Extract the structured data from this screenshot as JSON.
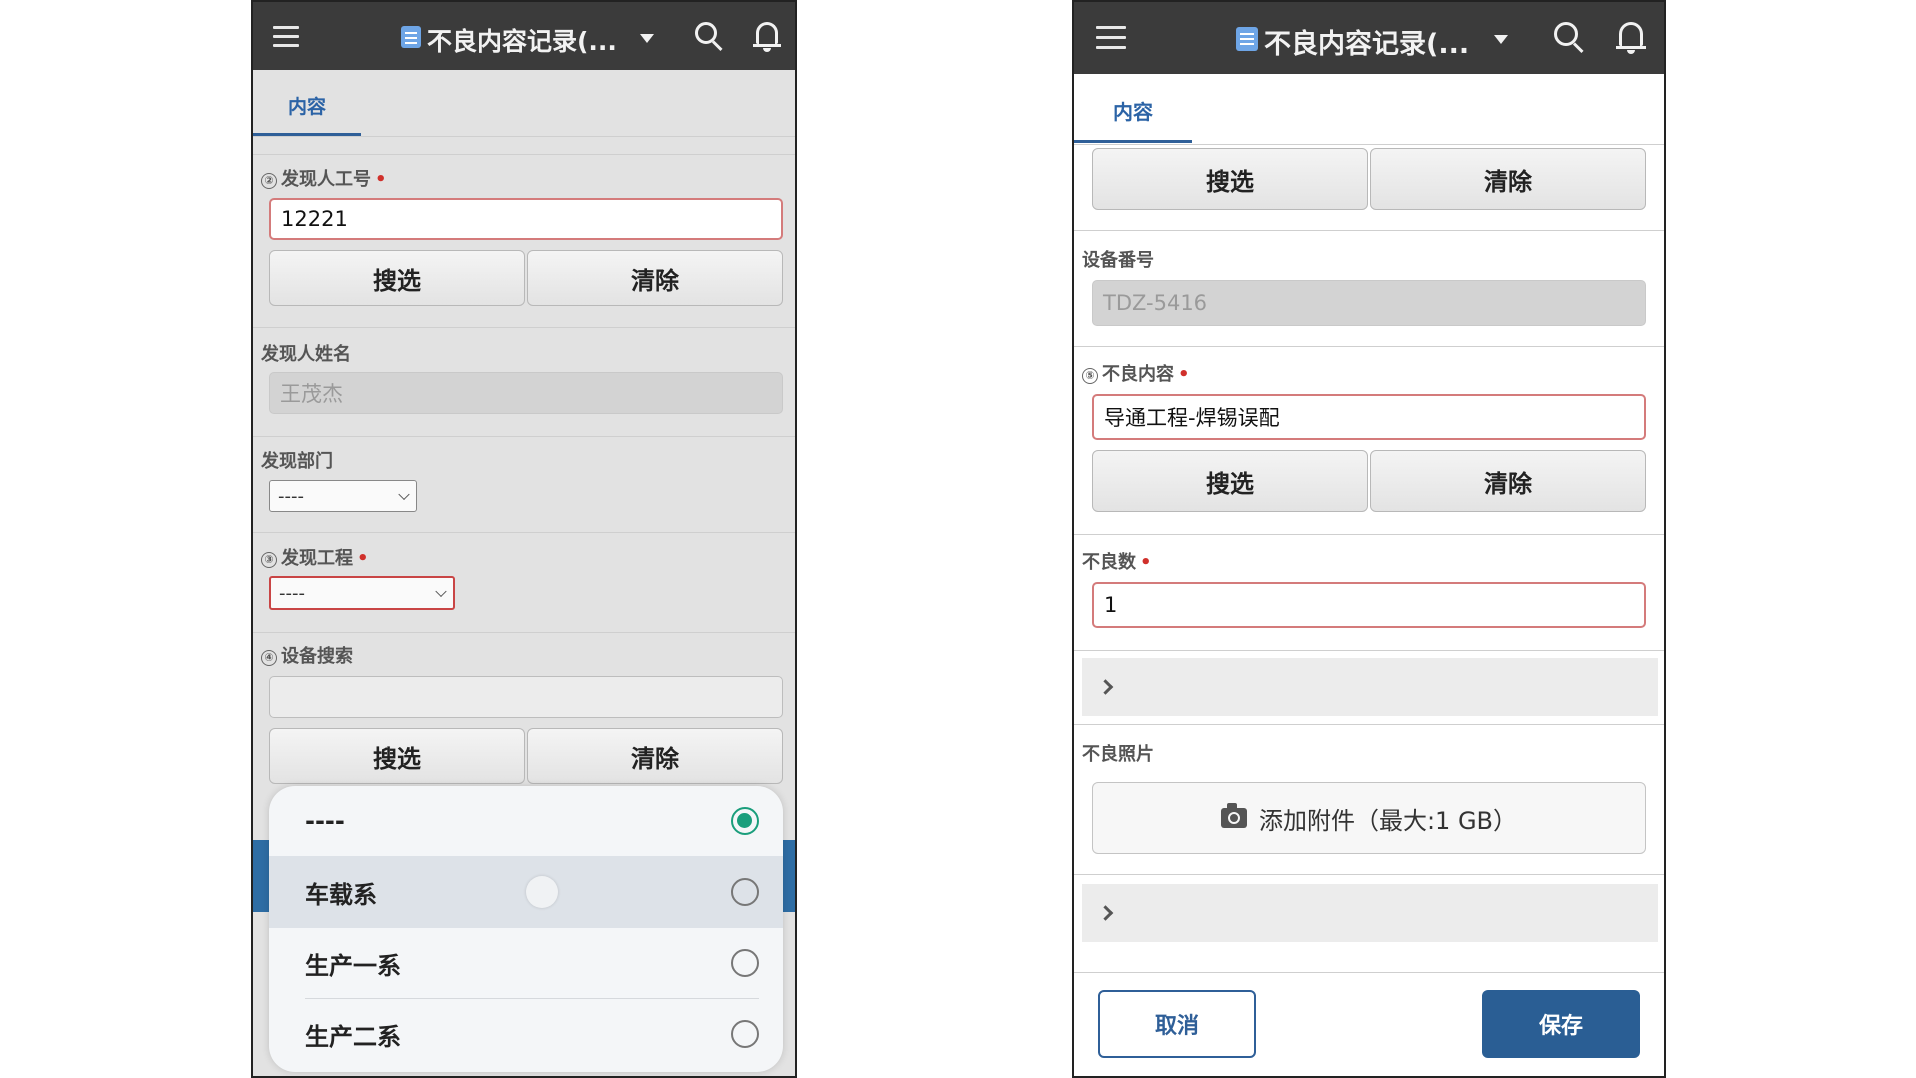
{
  "app": {
    "title": "不良内容记录(..."
  },
  "left": {
    "tab": "内容",
    "finder_id": {
      "num": "②",
      "label": "发现人工号",
      "value": "12221"
    },
    "finder_name": {
      "label": "发现人姓名",
      "value": "王茂杰"
    },
    "dept": {
      "label": "发现部门",
      "value": "----"
    },
    "process": {
      "num": "③",
      "label": "发现工程",
      "value": "----"
    },
    "device_search": {
      "num": "④",
      "label": "设备搜索",
      "value": ""
    },
    "search_label": "搜选",
    "clear_label": "清除",
    "picker": {
      "options": [
        "----",
        "车载系",
        "生产一系",
        "生产二系"
      ],
      "selected": "----"
    }
  },
  "right": {
    "tab": "内容",
    "search_label": "搜选",
    "clear_label": "清除",
    "device_no": {
      "label": "设备番号",
      "value": "TDZ-5416"
    },
    "defect": {
      "num": "⑤",
      "label": "不良内容",
      "value": "导通工程-焊锡误配"
    },
    "defect_count": {
      "label": "不良数",
      "value": "1"
    },
    "photo": {
      "label": "不良照片",
      "attach_label": "添加附件（最大:1 GB）"
    },
    "cancel_label": "取消",
    "save_label": "保存"
  }
}
